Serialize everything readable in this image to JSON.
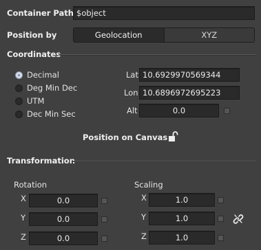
{
  "container_path": {
    "label": "Container Path",
    "value": "$object"
  },
  "position_by": {
    "label": "Position by",
    "options": [
      "Geolocation",
      "XYZ"
    ],
    "selected": "Geolocation"
  },
  "coordinates": {
    "title": "Coordinates",
    "formats": [
      "Decimal",
      "Deg Min Dec",
      "UTM",
      "Dec Min Sec"
    ],
    "selected_format": "Decimal",
    "lat_label": "Lat",
    "lat": "10.6929970569344",
    "lon_label": "Lon",
    "lon": "10.6896972695223",
    "alt_label": "Alt",
    "alt": "0.0",
    "position_on_canvas": "Position on Canvas"
  },
  "transformation": {
    "title": "Transformation",
    "rotation": {
      "label": "Rotation",
      "x_label": "X",
      "x": "0.0",
      "y_label": "Y",
      "y": "0.0",
      "z_label": "Z",
      "z": "0.0"
    },
    "scaling": {
      "label": "Scaling",
      "x_label": "X",
      "x": "1.0",
      "y_label": "Y",
      "y": "1.0",
      "z_label": "Z",
      "z": "1.0"
    }
  },
  "icons": {
    "lock": "unlock-icon",
    "link": "broken-link-icon"
  },
  "colors": {
    "background": "#404040",
    "field": "#2a2a2a",
    "active_segment": "#2b2b2b",
    "radio_selected": "#d8dce2"
  }
}
